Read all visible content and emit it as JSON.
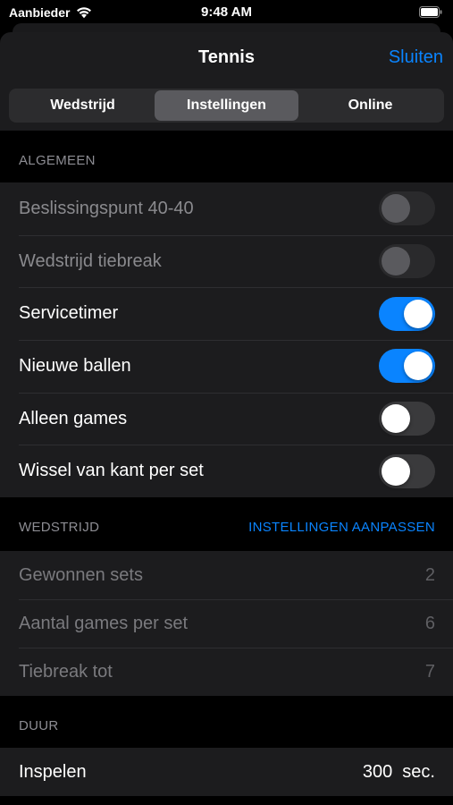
{
  "status_bar": {
    "carrier": "Aanbieder",
    "time": "9:48 AM",
    "icons": [
      "wifi-icon",
      "battery-icon"
    ]
  },
  "nav": {
    "title": "Tennis",
    "close_label": "Sluiten"
  },
  "tabs": [
    {
      "label": "Wedstrijd",
      "selected": false
    },
    {
      "label": "Instellingen",
      "selected": true
    },
    {
      "label": "Online",
      "selected": false
    }
  ],
  "sections": {
    "general": {
      "header": "ALGEMEEN",
      "rows": [
        {
          "label": "Beslissingspunt 40-40",
          "on": false,
          "enabled": false
        },
        {
          "label": "Wedstrijd tiebreak",
          "on": false,
          "enabled": false
        },
        {
          "label": "Servicetimer",
          "on": true,
          "enabled": true
        },
        {
          "label": "Nieuwe ballen",
          "on": true,
          "enabled": true
        },
        {
          "label": "Alleen games",
          "on": false,
          "enabled": true
        },
        {
          "label": "Wissel van kant per set",
          "on": false,
          "enabled": true
        }
      ]
    },
    "match": {
      "header": "WEDSTRIJD",
      "action": "INSTELLINGEN AANPASSEN",
      "rows": [
        {
          "label": "Gewonnen sets",
          "value": "2"
        },
        {
          "label": "Aantal games per set",
          "value": "6"
        },
        {
          "label": "Tiebreak tot",
          "value": "7"
        }
      ]
    },
    "duration": {
      "header": "DUUR",
      "rows": [
        {
          "label": "Inspelen",
          "value": "300  sec."
        }
      ]
    }
  },
  "colors": {
    "accent": "#0a84ff",
    "background": "#000000",
    "group_background": "#1c1c1e"
  }
}
